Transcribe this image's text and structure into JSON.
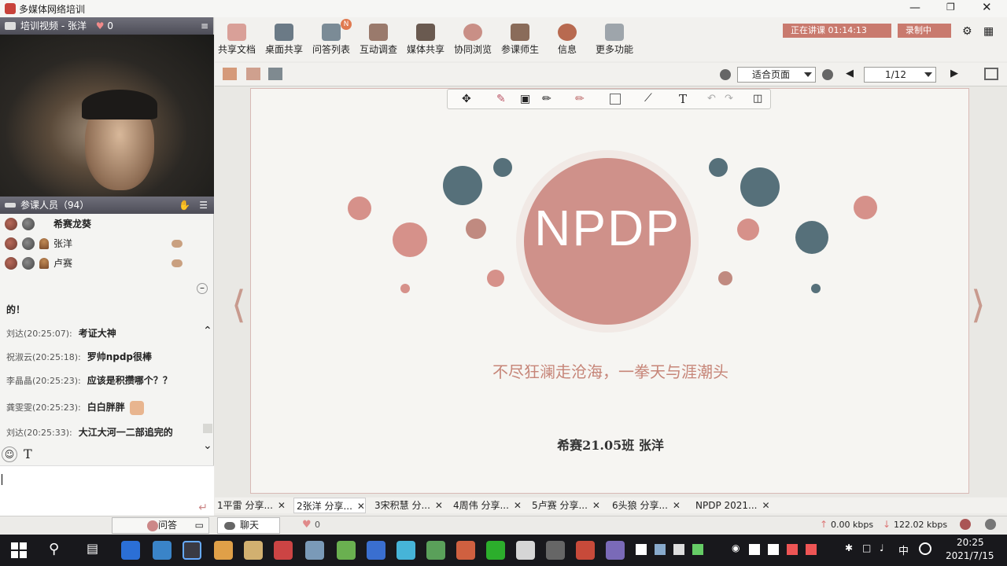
{
  "window": {
    "title": "多媒体网络培训"
  },
  "video_panel": {
    "header": "培训视频 - 张洋",
    "likes": "0"
  },
  "participants": {
    "header": "参课人员（94）",
    "users": [
      "希赛龙葵",
      "张洋",
      "卢赛"
    ]
  },
  "chat": {
    "prev_tail": "的！",
    "messages": [
      {
        "who": "刘达(20:25:07):",
        "msg": "考证大神"
      },
      {
        "who": "祝淑云(20:25:18):",
        "msg": "罗帅npdp很棒"
      },
      {
        "who": "李晶晶(20:25:23):",
        "msg": "应该是积攒哪个？？"
      },
      {
        "who": "龚雯雯(20:25:23):",
        "msg": "白白胖胖"
      },
      {
        "who": "刘达(20:25:33):",
        "msg": "大江大河一二部追完的"
      }
    ]
  },
  "toolbar": {
    "items": [
      "共享文档",
      "桌面共享",
      "问答列表",
      "互动调查",
      "媒体共享",
      "协同浏览",
      "参课师生",
      "信息",
      "更多功能"
    ],
    "badge": "N",
    "status_teaching": "正在讲课",
    "status_time": "01:14:13",
    "status_record": "录制中"
  },
  "viewbar": {
    "fit_label": "适合页面",
    "page": "1/12"
  },
  "slide": {
    "logo": "NPDP",
    "slogan": "不尽狂澜走沧海，一拳天与涯潮头",
    "footer": "希赛21.05班 张洋"
  },
  "doc_tabs": [
    "1平雷 分享...",
    "2张洋 分享...",
    "3宋积慧 分...",
    "4周伟 分享...",
    "5卢赛 分享...",
    "6头狼 分享...",
    "NPDP 2021..."
  ],
  "status": {
    "qa": "问答",
    "chat": "聊天",
    "likes": "0",
    "upload": "0.00 kbps",
    "download": "122.02 kbps"
  },
  "taskbar": {
    "time": "20:25",
    "date": "2021/7/15",
    "ime": "中"
  },
  "colors": {
    "accent": "#c98f86",
    "slate": "#56707a"
  }
}
